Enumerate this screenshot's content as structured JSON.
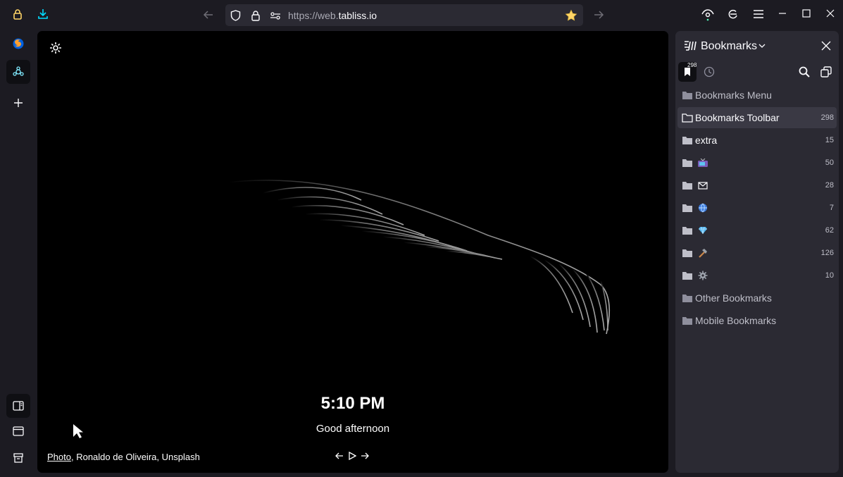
{
  "url": {
    "prefix": "https://web.",
    "domain": "tabliss.io"
  },
  "clock": {
    "time": "5:10 PM",
    "greeting": "Good afternoon"
  },
  "credit": {
    "photo_link": "Photo",
    "rest": ", Ronaldo de Oliveira, Unsplash"
  },
  "bookmarks_panel": {
    "title": "Bookmarks",
    "tab_count": "298",
    "items": [
      {
        "label": "Bookmarks Menu",
        "count": "",
        "icon": "folder"
      },
      {
        "label": "Bookmarks Toolbar",
        "count": "298",
        "icon": "folder-open"
      },
      {
        "label": "extra",
        "count": "15",
        "icon": "folder"
      },
      {
        "label": "",
        "count": "50",
        "icon": "tv-emoji"
      },
      {
        "label": "",
        "count": "28",
        "icon": "envelope-emoji"
      },
      {
        "label": "",
        "count": "7",
        "icon": "globe-emoji"
      },
      {
        "label": "",
        "count": "62",
        "icon": "gem-emoji"
      },
      {
        "label": "",
        "count": "126",
        "icon": "hammer-emoji"
      },
      {
        "label": "",
        "count": "10",
        "icon": "gear-emoji"
      },
      {
        "label": "Other Bookmarks",
        "count": "",
        "icon": "folder"
      },
      {
        "label": "Mobile Bookmarks",
        "count": "",
        "icon": "folder"
      }
    ]
  },
  "colors": {
    "window_bg": "#1c1b22",
    "panel_bg": "#2b2a33",
    "accent_blue": "#00ddff",
    "star_yellow": "#ffd567",
    "lock_yellow": "#ffd567"
  }
}
